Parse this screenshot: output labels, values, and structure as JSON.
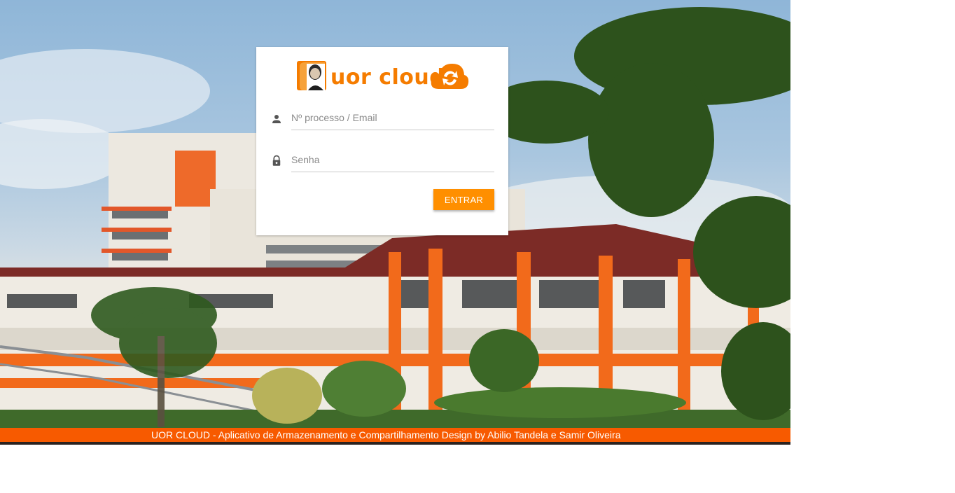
{
  "brand": {
    "name": "uor cloud",
    "accent_color": "#f57c00",
    "logo_icons": [
      "portrait-icon",
      "cloud-sync-icon"
    ]
  },
  "login": {
    "username_placeholder": "Nº processo / Email",
    "username_icon": "person-icon",
    "password_placeholder": "Senha",
    "password_icon": "lock-icon",
    "submit_label": "ENTRAR",
    "button_color": "#ff8f00"
  },
  "footer": {
    "text": "UOR CLOUD - Aplicativo de Armazenamento e Compartilhamento Design by Abilio Tandela e Samir Oliveira",
    "color": "#f75a00"
  }
}
